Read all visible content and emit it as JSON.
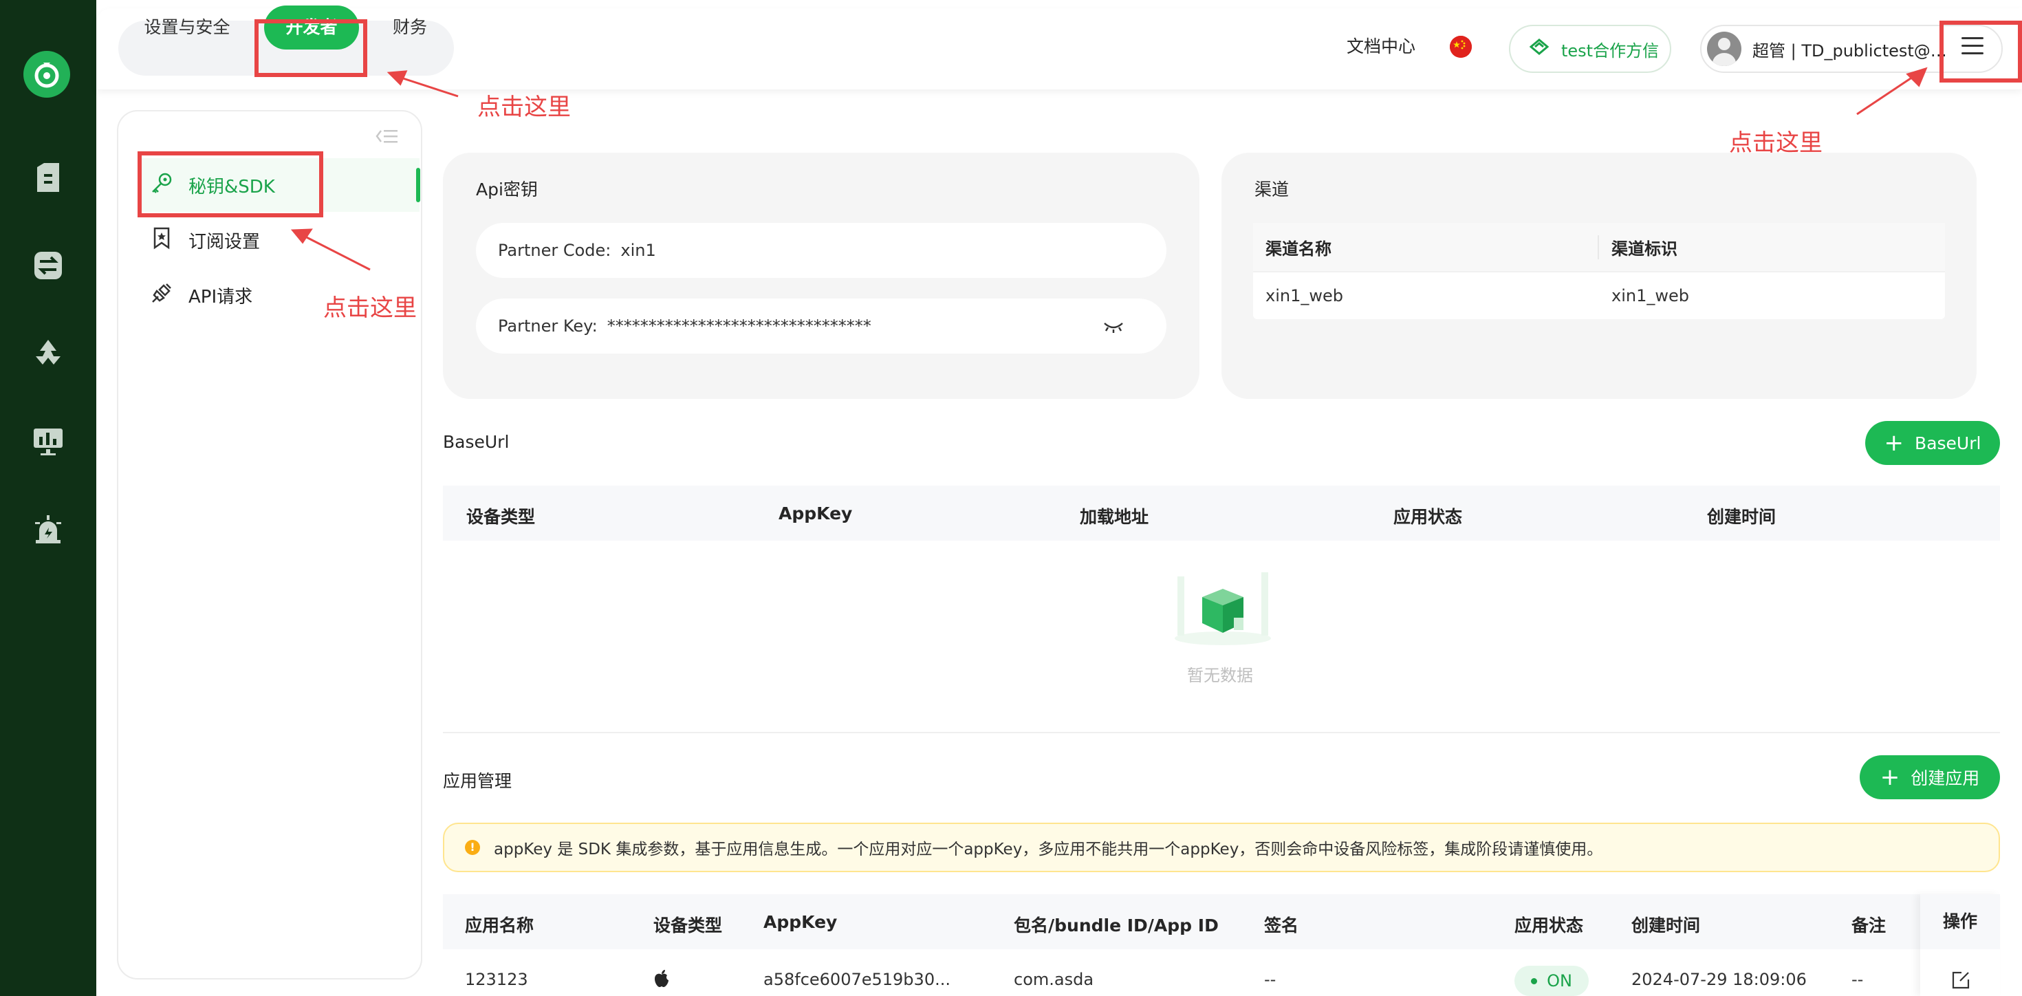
{
  "colors": {
    "accent": "#1db954",
    "rail": "#0f3016",
    "annotation": "#e84545"
  },
  "top_tabs": [
    "设置与安全",
    "开发者",
    "财务"
  ],
  "top_tabs_active": "开发者",
  "header": {
    "docs_link": "文档中心",
    "org_name": "test合作方信",
    "user_label": "超管 | TD_publictest@trusfort.com"
  },
  "annotations": [
    "点击这里",
    "点击这里",
    "点击这里"
  ],
  "sidebar": {
    "items": [
      {
        "label": "秘钥&SDK",
        "icon": "key-icon",
        "active": true
      },
      {
        "label": "订阅设置",
        "icon": "bookmark-icon",
        "active": false
      },
      {
        "label": "API请求",
        "icon": "plug-icon",
        "active": false
      }
    ]
  },
  "api_key_card": {
    "title": "Api密钥",
    "partner_code_label": "Partner Code:",
    "partner_code_value": "xin1",
    "partner_key_label": "Partner Key:",
    "partner_key_value": "********************************"
  },
  "channel_card": {
    "title": "渠道",
    "columns": [
      "渠道名称",
      "渠道标识"
    ],
    "rows": [
      [
        "xin1_web",
        "xin1_web"
      ]
    ]
  },
  "baseurl": {
    "title": "BaseUrl",
    "add_button": "BaseUrl",
    "columns": [
      "设备类型",
      "AppKey",
      "加载地址",
      "应用状态",
      "创建时间"
    ],
    "empty_text": "暂无数据"
  },
  "apps": {
    "title": "应用管理",
    "create_button": "创建应用",
    "notice": "appKey 是 SDK 集成参数，基于应用信息生成。一个应用对应一个appKey，多应用不能共用一个appKey，否则会命中设备风险标签，集成阶段请谨慎使用。",
    "columns": [
      "应用名称",
      "设备类型",
      "AppKey",
      "包名/bundle ID/App ID",
      "签名",
      "应用状态",
      "创建时间",
      "备注",
      "操作"
    ],
    "rows": [
      {
        "name": "123123",
        "device": "apple-icon",
        "appkey": "a58fce6007e519b30...",
        "bundle": "com.asda",
        "signature": "--",
        "status": "ON",
        "created": "2024-07-29 18:09:06",
        "remark": "--"
      }
    ]
  }
}
